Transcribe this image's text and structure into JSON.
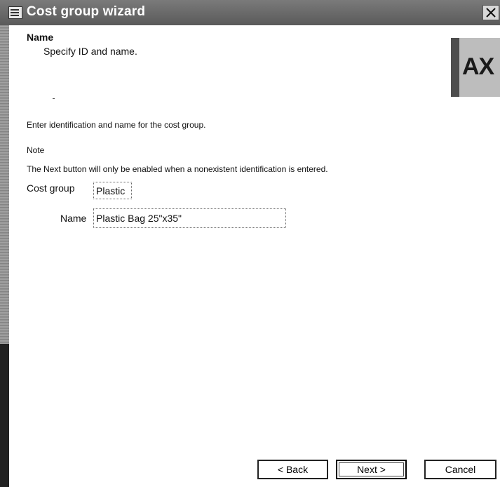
{
  "window": {
    "title": "Cost group wizard",
    "icon": "wizard-window-icon",
    "close_icon": "close-icon"
  },
  "header": {
    "title": "Name",
    "subtitle": "Specify ID and name.",
    "logo_text": "AX"
  },
  "body": {
    "instruction": "Enter identification and name for the cost group.",
    "note_label": "Note",
    "note_text": "The Next button will only be enabled when a nonexistent identification is entered."
  },
  "form": {
    "cost_group_label": "Cost group",
    "cost_group_value": "Plastic",
    "name_label": "Name",
    "name_value": "Plastic Bag 25\"x35\""
  },
  "buttons": {
    "back": "< Back",
    "next": "Next >",
    "cancel": "Cancel"
  }
}
